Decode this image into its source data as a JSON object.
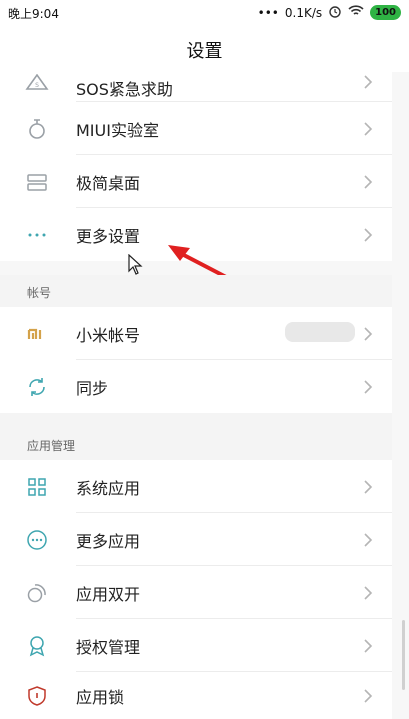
{
  "status": {
    "time": "晚上9:04",
    "dots": "•••",
    "speed": "0.1K/s",
    "battery": "100"
  },
  "header": {
    "title": "设置"
  },
  "items_top": [
    {
      "label": "SOS紧急求助",
      "icon": "sos-icon"
    },
    {
      "label": "MIUI实验室",
      "icon": "flask-icon"
    },
    {
      "label": "极简桌面",
      "icon": "desktop-icon"
    },
    {
      "label": "更多设置",
      "icon": "more-dots-icon"
    }
  ],
  "sections": {
    "account": {
      "header": "帐号",
      "items": [
        {
          "label": "小米帐号",
          "icon": "mi-logo-icon"
        },
        {
          "label": "同步",
          "icon": "sync-icon"
        }
      ]
    },
    "apps": {
      "header": "应用管理",
      "items": [
        {
          "label": "系统应用",
          "icon": "grid-icon"
        },
        {
          "label": "更多应用",
          "icon": "more-circle-icon"
        },
        {
          "label": "应用双开",
          "icon": "dual-app-icon"
        },
        {
          "label": "授权管理",
          "icon": "ribbon-icon"
        },
        {
          "label": "应用锁",
          "icon": "shield-lock-icon"
        }
      ]
    }
  },
  "colors": {
    "accent_gray": "#9aa0a6",
    "mi_orange": "#d4a24a",
    "teal": "#3fa6b0",
    "arrow_red": "#e02020"
  }
}
